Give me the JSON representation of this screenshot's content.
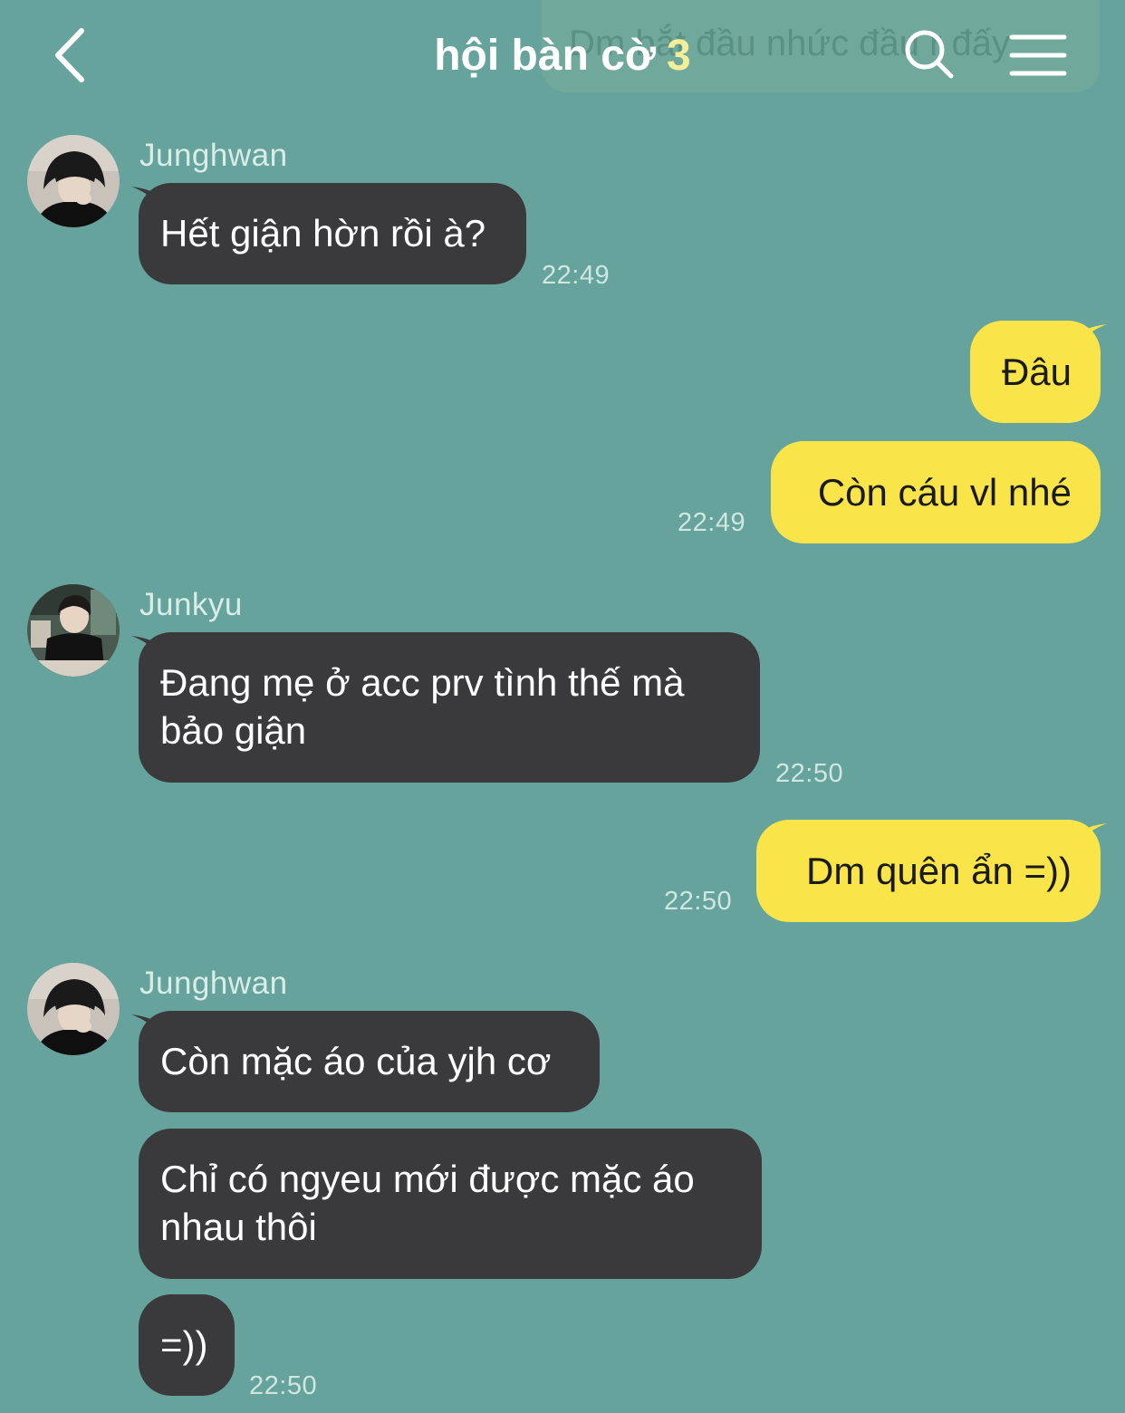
{
  "header": {
    "title": "hội bàn cờ",
    "member_count": "3",
    "ghost_preview": "Dm bắt đầu nhức đầu r đấy",
    "back_icon": "chevron-left-icon",
    "search_icon": "search-icon",
    "menu_icon": "hamburger-menu-icon"
  },
  "colors": {
    "background": "#66a39c",
    "incoming_bubble": "#3a393b",
    "outgoing_bubble": "#f9e54a"
  },
  "messages": {
    "m1": {
      "sender": "Junghwan",
      "text": "Hết giận hờn rồi à?",
      "time": "22:49"
    },
    "m2": {
      "text": "Đâu"
    },
    "m3": {
      "text": "Còn cáu vl nhé",
      "time": "22:49"
    },
    "m4": {
      "sender": "Junkyu",
      "line1": "Đang mẹ ở acc prv tình thế mà",
      "line2": "bảo giận",
      "time": "22:50"
    },
    "m5": {
      "text": "Dm quên ẩn =))",
      "time": "22:50"
    },
    "m6": {
      "sender": "Junghwan",
      "text": "Còn mặc áo của yjh cơ"
    },
    "m7": {
      "line1": "Chỉ có ngyeu mới được mặc áo",
      "line2": "nhau thôi"
    },
    "m8": {
      "text": "=))",
      "time": "22:50"
    }
  }
}
